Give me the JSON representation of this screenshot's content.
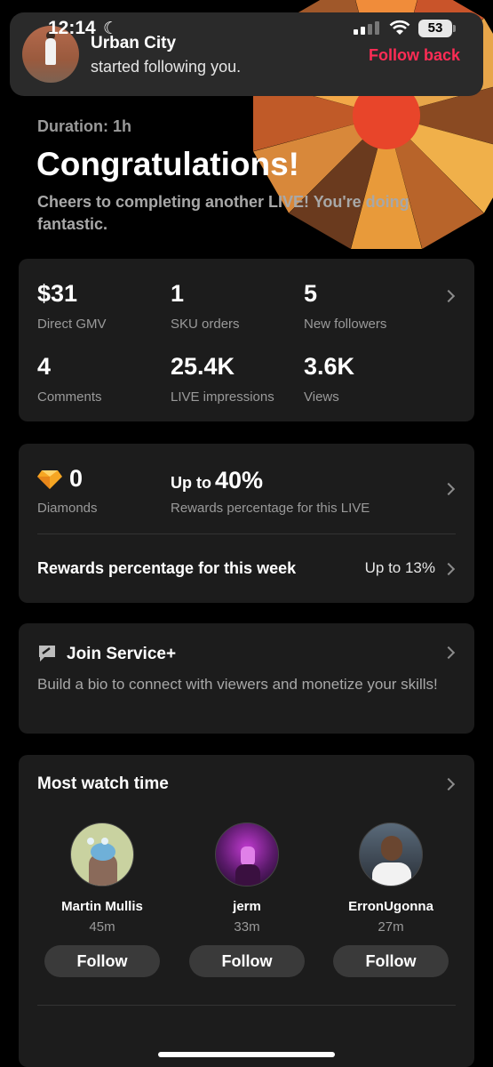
{
  "status_bar": {
    "time": "12:14",
    "battery": "53"
  },
  "notification": {
    "name": "Urban City",
    "message": "started following you.",
    "action": "Follow back"
  },
  "header": {
    "duration": "Duration: 1h",
    "title": "Congratulations!",
    "subtitle": "Cheers to completing another LIVE! You're doing fantastic."
  },
  "stats": [
    {
      "value": "$31",
      "label": "Direct GMV"
    },
    {
      "value": "1",
      "label": "SKU orders"
    },
    {
      "value": "5",
      "label": "New followers"
    },
    {
      "value": "4",
      "label": "Comments"
    },
    {
      "value": "25.4K",
      "label": "LIVE impressions"
    },
    {
      "value": "3.6K",
      "label": "Views"
    }
  ],
  "rewards": {
    "diamonds_value": "0",
    "diamonds_label": "Diamonds",
    "upto_prefix": "Up to",
    "upto_value": "40%",
    "upto_label": "Rewards percentage for this LIVE",
    "week_label": "Rewards percentage for this week",
    "week_value": "Up to 13%"
  },
  "service": {
    "title": "Join Service+",
    "description": "Build a bio to connect with viewers and monetize your skills!"
  },
  "most_watch": {
    "title": "Most watch time",
    "viewers": [
      {
        "name": "Martin Mullis",
        "time": "45m",
        "button": "Follow"
      },
      {
        "name": "jerm",
        "time": "33m",
        "button": "Follow"
      },
      {
        "name": "ErronUgonna",
        "time": "27m",
        "button": "Follow"
      }
    ]
  },
  "colors": {
    "accent": "#fe2c55",
    "card": "#1c1c1c",
    "background": "#000000"
  }
}
